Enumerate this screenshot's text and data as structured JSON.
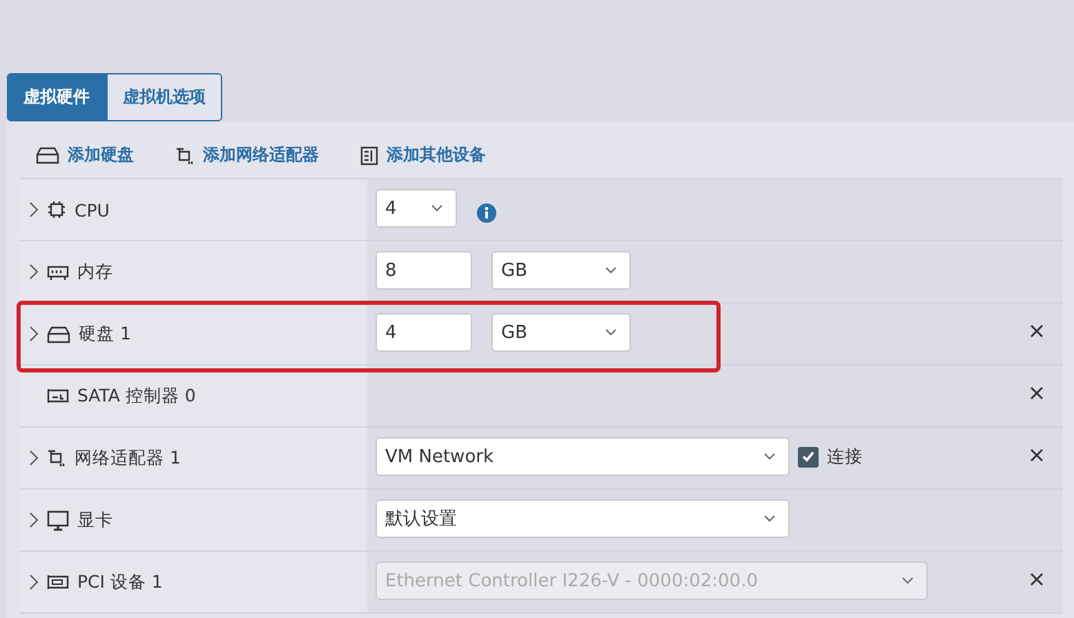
{
  "tabs": [
    {
      "label": "虚拟硬件",
      "selected": true
    },
    {
      "label": "虚拟机选项",
      "selected": false
    }
  ],
  "toolbar": [
    {
      "kind": "disk",
      "label": "添加硬盘"
    },
    {
      "kind": "network",
      "label": "添加网络适配器"
    },
    {
      "kind": "other",
      "label": "添加其他设备"
    }
  ],
  "rows": [
    {
      "kind": "cpu",
      "label": "CPU",
      "expandable": true,
      "removable": false,
      "highlighted": false,
      "controls": [
        {
          "kind": "small-select",
          "value": "4",
          "disabled": false
        },
        {
          "kind": "info"
        }
      ]
    },
    {
      "kind": "memory",
      "label": "内存",
      "expandable": true,
      "removable": false,
      "highlighted": false,
      "controls": [
        {
          "kind": "number-input",
          "value": "8"
        },
        {
          "kind": "unit-select",
          "value": "GB",
          "disabled": false
        }
      ]
    },
    {
      "kind": "disk",
      "label": "硬盘 1",
      "expandable": true,
      "removable": true,
      "highlighted": true,
      "controls": [
        {
          "kind": "number-input",
          "value": "4"
        },
        {
          "kind": "unit-select",
          "value": "GB",
          "disabled": false
        }
      ]
    },
    {
      "kind": "controller",
      "label": "SATA 控制器 0",
      "expandable": false,
      "removable": true,
      "highlighted": false,
      "controls": []
    },
    {
      "kind": "network",
      "label": "网络适配器 1",
      "expandable": true,
      "removable": true,
      "highlighted": false,
      "controls": [
        {
          "kind": "wide-select",
          "value": "VM Network",
          "disabled": false
        },
        {
          "kind": "checkbox",
          "label": "连接",
          "checked": true
        }
      ]
    },
    {
      "kind": "display",
      "label": "显卡",
      "expandable": true,
      "removable": false,
      "highlighted": false,
      "controls": [
        {
          "kind": "wide-select",
          "value": "默认设置",
          "disabled": false
        }
      ]
    },
    {
      "kind": "pci",
      "label": "PCI 设备 1",
      "expandable": true,
      "removable": true,
      "highlighted": false,
      "controls": [
        {
          "kind": "device-select",
          "value": "Ethernet Controller I226-V - 0000:02:00.0",
          "disabled": true
        }
      ]
    }
  ]
}
